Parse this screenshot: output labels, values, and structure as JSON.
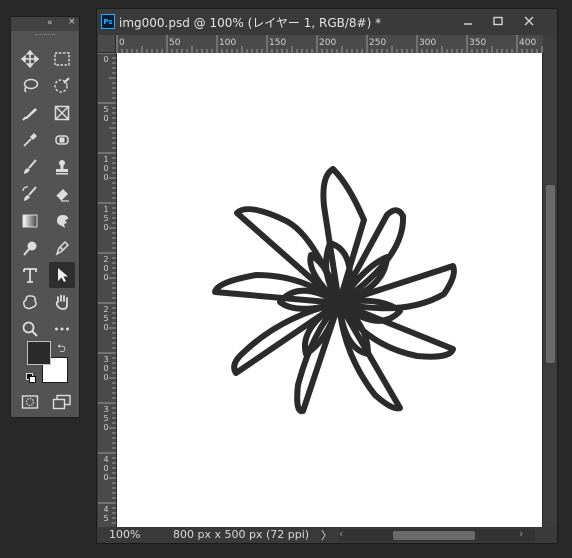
{
  "tools_panel": {
    "collapse_label": "«",
    "close_label": "×",
    "tools": [
      {
        "name": "move-tool"
      },
      {
        "name": "marquee-tool"
      },
      {
        "name": "lasso-tool"
      },
      {
        "name": "quick-selection-tool"
      },
      {
        "name": "crop-tool"
      },
      {
        "name": "frame-tool"
      },
      {
        "name": "eyedropper-tool"
      },
      {
        "name": "spot-healing-tool"
      },
      {
        "name": "brush-tool"
      },
      {
        "name": "clone-stamp-tool"
      },
      {
        "name": "history-brush-tool"
      },
      {
        "name": "eraser-tool"
      },
      {
        "name": "gradient-tool"
      },
      {
        "name": "smudge-tool"
      },
      {
        "name": "dodge-tool"
      },
      {
        "name": "pen-tool"
      },
      {
        "name": "type-tool"
      },
      {
        "name": "path-selection-tool",
        "active": true
      },
      {
        "name": "custom-shape-tool"
      },
      {
        "name": "hand-tool"
      },
      {
        "name": "zoom-tool"
      },
      {
        "name": "more-tools"
      }
    ],
    "foreground_color": "#2b2b2b",
    "background_color": "#ffffff"
  },
  "document": {
    "title": "img000.psd @ 100% (レイヤー 1, RGB/8#) *",
    "icon_label": "Ps",
    "window_buttons": {
      "minimize": "—",
      "maximize": "□",
      "close": "✕"
    },
    "ruler_h": [
      "0",
      "50",
      "100",
      "150",
      "200",
      "250",
      "300",
      "350",
      "400"
    ],
    "ruler_v": [
      "0",
      "5\n0",
      "1\n0\n0",
      "1\n5\n0",
      "2\n0\n0",
      "2\n5\n0",
      "3\n0\n0",
      "3\n5\n0",
      "4\n0\n0",
      "4\n5"
    ],
    "canvas_color": "#ffffff",
    "stroke_color": "#2b2b2b"
  },
  "status": {
    "zoom": "100%",
    "doc_size": "800 px x 500 px (72 ppi)",
    "more": "〉"
  }
}
